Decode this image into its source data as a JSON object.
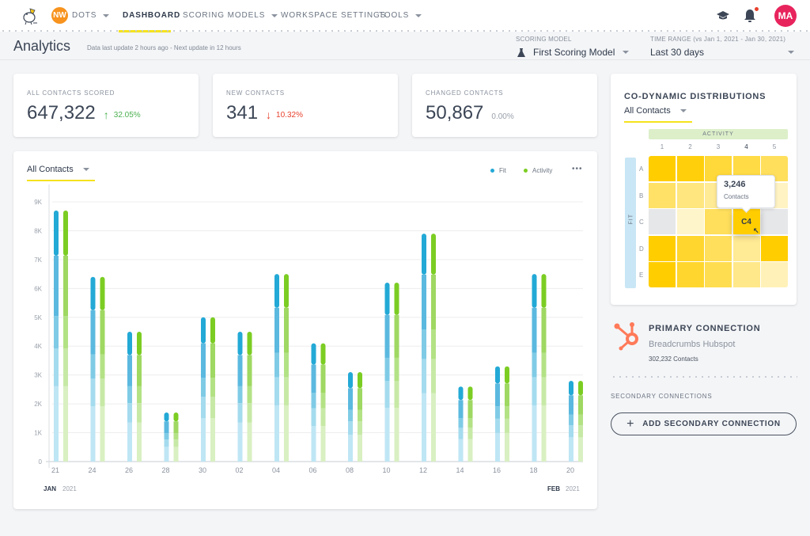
{
  "nav": {
    "workspace_initials": "NW",
    "workspace_name": "DOTS",
    "items": [
      {
        "label": "DASHBOARD",
        "active": true,
        "has_caret": false
      },
      {
        "label": "SCORING MODELS",
        "active": false,
        "has_caret": true
      },
      {
        "label": "WORKSPACE SETTINGS",
        "active": false,
        "has_caret": false
      },
      {
        "label": "TOOLS",
        "active": false,
        "has_caret": true
      }
    ],
    "icons": [
      "graduation-cap-icon",
      "bell-icon"
    ],
    "notification_dot": true,
    "user_initials": "MA"
  },
  "header": {
    "title": "Analytics",
    "update_note": "Data last update 2 hours ago - Next update in 12 hours",
    "scoring_model_label": "SCORING MODEL",
    "scoring_model_value": "First Scoring Model",
    "time_range_label": "TIME RANGE (vs Jan 1, 2021 - Jan 30, 2021)",
    "time_range_value": "Last 30 days"
  },
  "stats": [
    {
      "label": "ALL CONTACTS SCORED",
      "value": "647,322",
      "delta": "32.05%",
      "trend": "up"
    },
    {
      "label": "NEW CONTACTS",
      "value": "341",
      "delta": "10.32%",
      "trend": "down"
    },
    {
      "label": "CHANGED CONTACTS",
      "value": "50,867",
      "delta": "0.00%",
      "trend": "flat"
    }
  ],
  "chart_panel": {
    "filter": "All Contacts",
    "more_label": "•••"
  },
  "chart_data": {
    "type": "bar",
    "title": "",
    "xlabel": "",
    "ylabel": "",
    "categories": [
      "21",
      "24",
      "26",
      "28",
      "30",
      "02",
      "04",
      "06",
      "08",
      "10",
      "12",
      "14",
      "16",
      "18",
      "20"
    ],
    "series": [
      {
        "name": "Fit",
        "color": "#23a9d6",
        "values": [
          8700,
          6400,
          4500,
          1700,
          5000,
          4500,
          6500,
          4100,
          3100,
          6200,
          7900,
          2600,
          3300,
          6500,
          2800
        ]
      },
      {
        "name": "Activity",
        "color": "#7ccd23",
        "values": [
          8700,
          6400,
          4500,
          1700,
          5000,
          4500,
          6500,
          4100,
          3100,
          6200,
          7900,
          2600,
          3300,
          6500,
          2800
        ]
      }
    ],
    "yticks": [
      "0",
      "1K",
      "2K",
      "3K",
      "4K",
      "5K",
      "6K",
      "7K",
      "8K",
      "9K"
    ],
    "ylim": [
      0,
      9000
    ],
    "grid": true,
    "legend": "top-right",
    "x_period_start": {
      "month": "JAN",
      "year": "2021"
    },
    "x_period_end": {
      "month": "FEB",
      "year": "2021"
    }
  },
  "heatmap": {
    "title": "CO-DYNAMIC DISTRIBUTIONS",
    "filter": "All Contacts",
    "x_label": "ACTIVITY",
    "y_label": "FIT",
    "columns": [
      "1",
      "2",
      "3",
      "4",
      "5"
    ],
    "rows": [
      "A",
      "B",
      "C",
      "D",
      "E"
    ],
    "intensity": [
      [
        1.0,
        0.95,
        0.75,
        0.7,
        0.6
      ],
      [
        0.55,
        0.45,
        0.35,
        0.3,
        0.15
      ],
      [
        null,
        0.12,
        0.6,
        1.0,
        null
      ],
      [
        1.0,
        0.8,
        0.6,
        0.35,
        1.0
      ],
      [
        1.0,
        0.8,
        0.65,
        0.4,
        0.2
      ]
    ],
    "selected_cell": "C4",
    "tooltip_value": "3,246",
    "tooltip_label": "Contacts"
  },
  "connections": {
    "primary_title": "PRIMARY CONNECTION",
    "primary_name": "Breadcrumbs Hubspot",
    "primary_count": "302,232 Contacts",
    "secondary_title": "SECONDARY CONNECTIONS",
    "add_button": "ADD SECONDARY CONNECTION"
  },
  "colors": {
    "accent_yellow": "#f5e21d",
    "fit_blue": "#23a9d6",
    "activity_green": "#7ccd23",
    "hubspot_orange": "#ff7a59",
    "avatar_pink": "#e8245d",
    "workspace_orange": "#f7931e"
  }
}
